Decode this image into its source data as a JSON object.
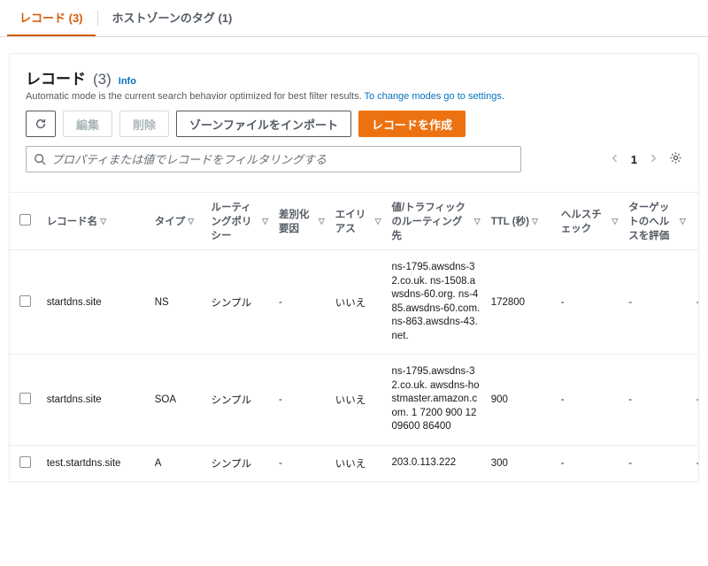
{
  "tabs": {
    "records": "レコード (3)",
    "tags": "ホストゾーンのタグ (1)"
  },
  "header": {
    "title": "レコード",
    "count": "(3)",
    "info": "Info",
    "subtext_prefix": "Automatic mode is the current search behavior optimized for best filter results. ",
    "subtext_link": "To change modes go to settings."
  },
  "toolbar": {
    "refresh": "⟳",
    "edit": "編集",
    "delete": "削除",
    "import": "ゾーンファイルをインポート",
    "create": "レコードを作成"
  },
  "filter": {
    "placeholder": "プロパティまたは値でレコードをフィルタリングする"
  },
  "pager": {
    "page": "1"
  },
  "columns": {
    "name": "レコード名",
    "type": "タイプ",
    "routing": "ルーティングポリシー",
    "diff": "差別化要因",
    "alias": "エイリアス",
    "value": "値/トラフィックのルーティング先",
    "ttl": "TTL (秒)",
    "hc": "ヘルスチェック",
    "ev": "ターゲットのヘルスを評価"
  },
  "rows": [
    {
      "name": "startdns.site",
      "type": "NS",
      "routing": "シンプル",
      "diff": "-",
      "alias": "いいえ",
      "value": "ns-1795.awsdns-32.co.uk. ns-1508.awsdns-60.org. ns-485.awsdns-60.com. ns-863.awsdns-43.net.",
      "ttl": "172800",
      "hc": "-",
      "ev": "-",
      "last": "-"
    },
    {
      "name": "startdns.site",
      "type": "SOA",
      "routing": "シンプル",
      "diff": "-",
      "alias": "いいえ",
      "value": "ns-1795.awsdns-32.co.uk. awsdns-hostmaster.amazon.com. 1 7200 900 1209600 86400",
      "ttl": "900",
      "hc": "-",
      "ev": "-",
      "last": "-"
    },
    {
      "name": "test.startdns.site",
      "type": "A",
      "routing": "シンプル",
      "diff": "-",
      "alias": "いいえ",
      "value": "203.0.113.222",
      "ttl": "300",
      "hc": "-",
      "ev": "-",
      "last": "-"
    }
  ]
}
